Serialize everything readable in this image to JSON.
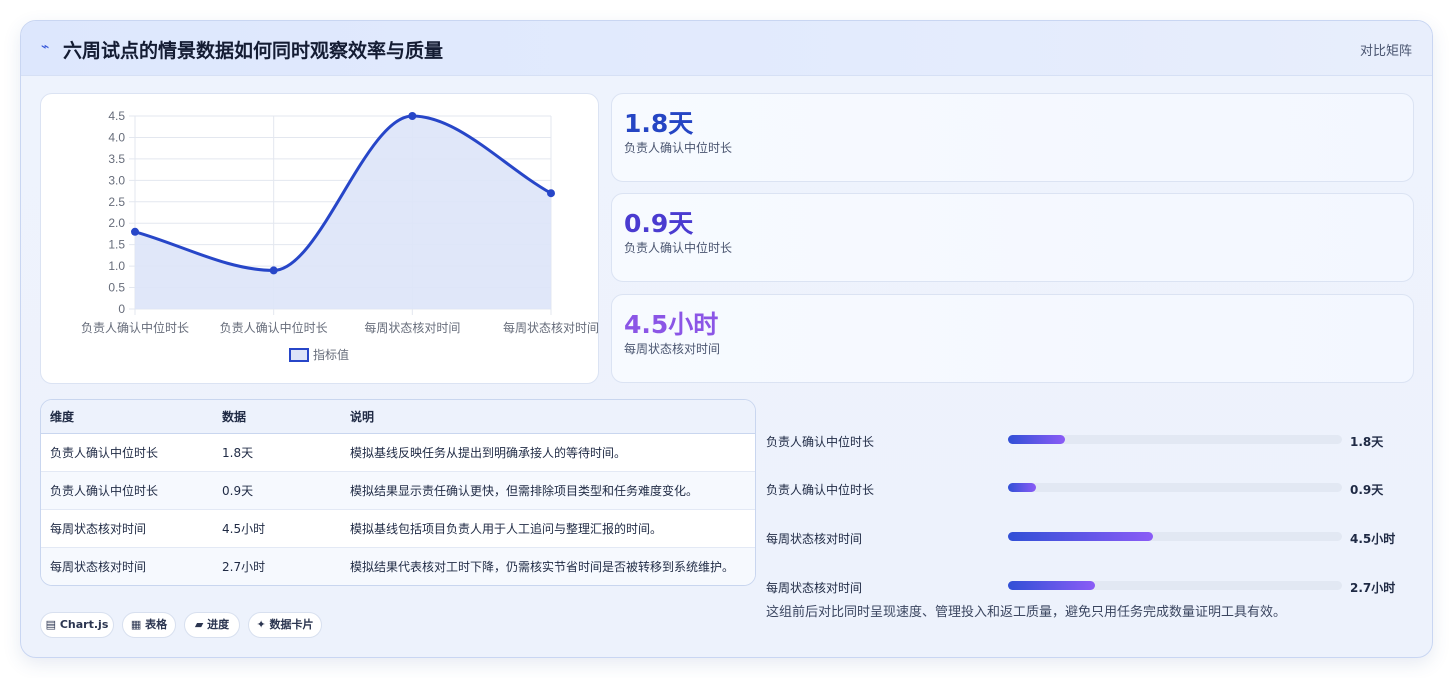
{
  "header": {
    "icon": "pulse-icon",
    "title": "六周试点的情景数据如何同时观察效率与质量",
    "tag": "对比矩阵"
  },
  "chart_data": {
    "type": "line",
    "categories": [
      "负责人确认中位时长",
      "负责人确认中位时长",
      "每周状态核对时间",
      "每周状态核对时间"
    ],
    "series": [
      {
        "name": "指标值",
        "values": [
          1.8,
          0.9,
          4.5,
          2.7
        ]
      }
    ],
    "yticks": [
      "0",
      "0.5",
      "1.0",
      "1.5",
      "2.0",
      "2.5",
      "3.0",
      "3.5",
      "4.0",
      "4.5"
    ],
    "ylim": [
      0,
      4.5
    ],
    "fill": true,
    "smooth": true,
    "grid": true,
    "legend": "bottom",
    "colors": {
      "line": "#2746c8",
      "fill": "#dde4f8"
    }
  },
  "stats": [
    {
      "value": "1.8天",
      "label": "负责人确认中位时长",
      "color": "#2545c4"
    },
    {
      "value": "0.9天",
      "label": "负责人确认中位时长",
      "color": "#4a3bd0"
    },
    {
      "value": "4.5小时",
      "label": "每周状态核对时间",
      "color": "#8b55e6"
    }
  ],
  "table": {
    "headers": [
      "维度",
      "数据",
      "说明"
    ],
    "rows": [
      [
        "负责人确认中位时长",
        "1.8天",
        "模拟基线反映任务从提出到明确承接人的等待时间。"
      ],
      [
        "负责人确认中位时长",
        "0.9天",
        "模拟结果显示责任确认更快，但需排除项目类型和任务难度变化。"
      ],
      [
        "每周状态核对时间",
        "4.5小时",
        "模拟基线包括项目负责人用于人工追问与整理汇报的时间。"
      ],
      [
        "每周状态核对时间",
        "2.7小时",
        "模拟结果代表核对工时下降，仍需核实节省时间是否被转移到系统维护。"
      ]
    ]
  },
  "progress": [
    {
      "label": "负责人确认中位时长",
      "value": "1.8天",
      "fraction": 0.17
    },
    {
      "label": "负责人确认中位时长",
      "value": "0.9天",
      "fraction": 0.085
    },
    {
      "label": "每周状态核对时间",
      "value": "4.5小时",
      "fraction": 0.435
    },
    {
      "label": "每周状态核对时间",
      "value": "2.7小时",
      "fraction": 0.26
    }
  ],
  "note": "这组前后对比同时呈现速度、管理投入和返工质量，避免只用任务完成数量证明工具有效。",
  "chips": [
    {
      "icon": "chart-icon",
      "glyph": "▤",
      "label": "Chart.js"
    },
    {
      "icon": "table-icon",
      "glyph": "▦",
      "label": "表格"
    },
    {
      "icon": "progress-icon",
      "glyph": "▰",
      "label": "进度"
    },
    {
      "icon": "card-icon",
      "glyph": "✦",
      "label": "数据卡片"
    }
  ]
}
